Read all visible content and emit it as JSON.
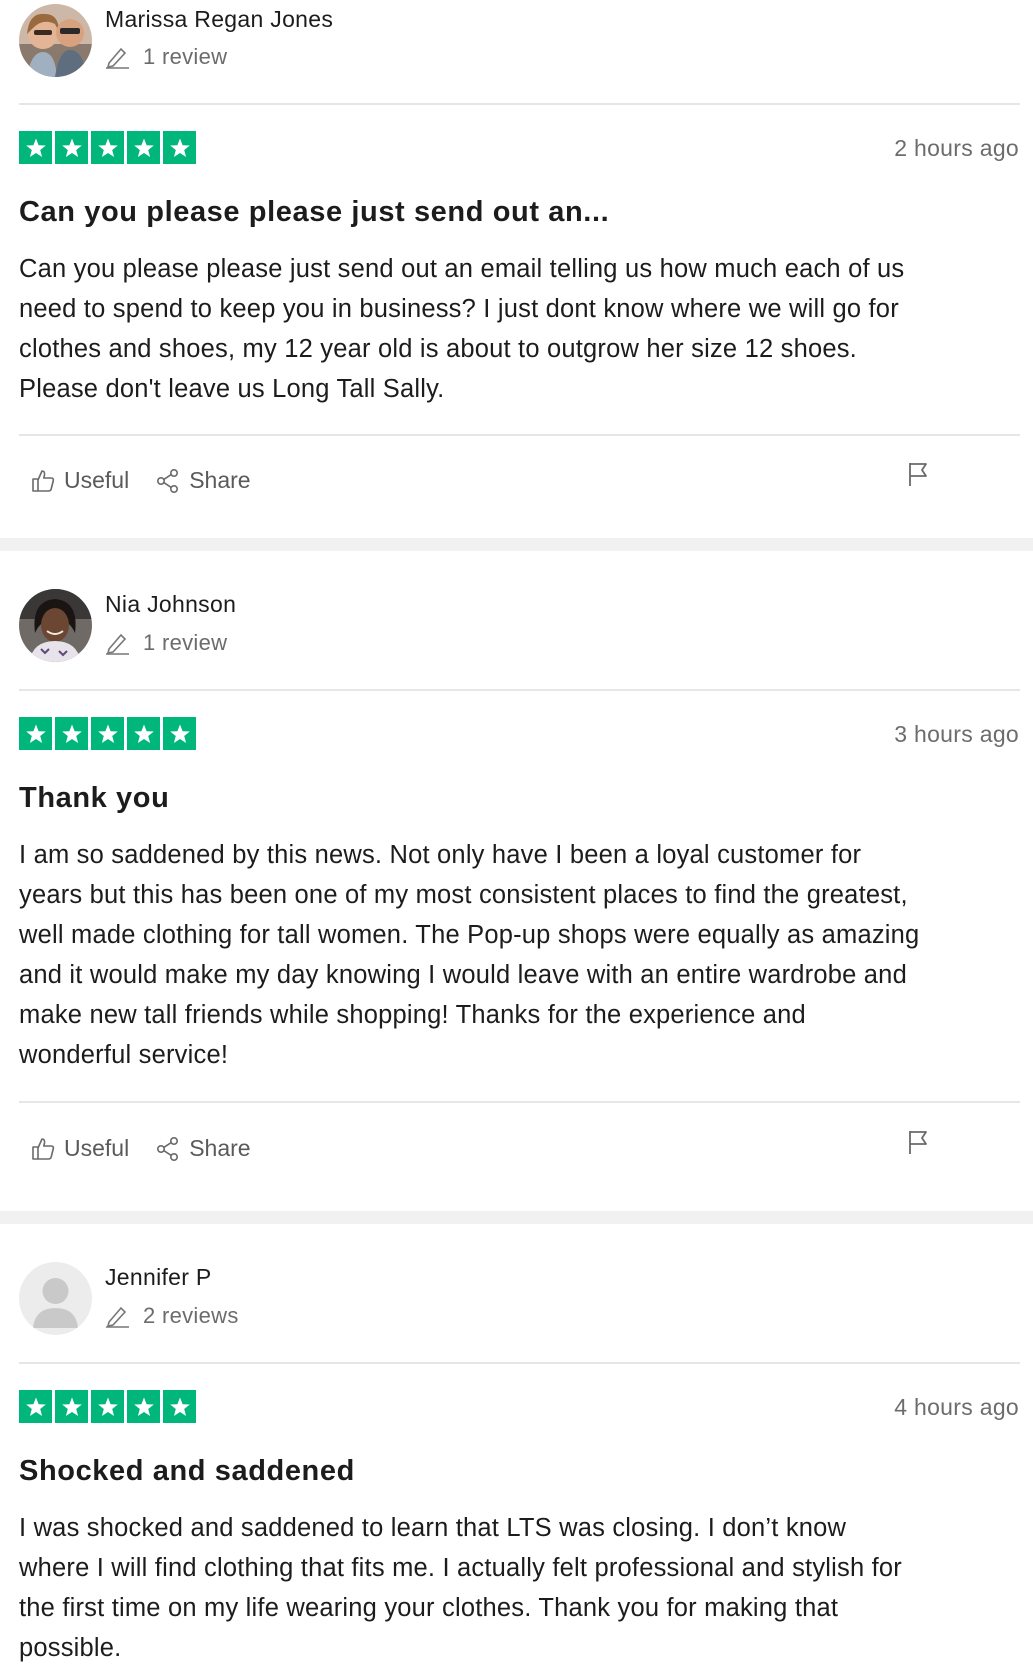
{
  "reviews": [
    {
      "reviewer": "Marissa Regan Jones",
      "review_count": "1 review",
      "rating": 5,
      "date": "2 hours ago",
      "title": "Can you please please just send out an...",
      "lines": [
        "Can you please please just send out an email telling us how much each of us",
        "need to spend to keep you in business? I just dont know where we will go for",
        "clothes and shoes, my 12 year old is about to outgrow her size 12 shoes.",
        "Please don't leave us Long Tall Sally."
      ],
      "useful_label": "Useful",
      "share_label": "Share"
    },
    {
      "reviewer": "Nia Johnson",
      "review_count": "1 review",
      "rating": 5,
      "date": "3 hours ago",
      "title": "Thank you",
      "lines": [
        "I am so saddened by this news. Not only have I been a loyal customer for",
        "years but this has been one of my most consistent places to find the greatest,",
        "well made clothing for tall women. The Pop-up shops were equally as amazing",
        "and it would make my day knowing I would leave with an entire wardrobe and",
        "make new tall friends while shopping! Thanks for the experience and",
        "wonderful service!"
      ],
      "useful_label": "Useful",
      "share_label": "Share"
    },
    {
      "reviewer": "Jennifer P",
      "review_count": "2 reviews",
      "rating": 5,
      "date": "4 hours ago",
      "title": "Shocked and saddened",
      "lines": [
        "I was shocked and saddened to learn that LTS was closing. I don’t know",
        "where I will find clothing that fits me. I actually felt professional and stylish for",
        "the first time on my life wearing your clothes. Thank you for making that",
        "possible."
      ]
    }
  ],
  "colors": {
    "star_green": "#00b67a",
    "text": "#191919",
    "muted": "#6c6c6c",
    "divider": "#e6e6e6",
    "separator": "#f1f1f1"
  },
  "icons": [
    "pencil-icon",
    "star-icon",
    "thumbs-up-icon",
    "share-icon",
    "flag-icon"
  ]
}
